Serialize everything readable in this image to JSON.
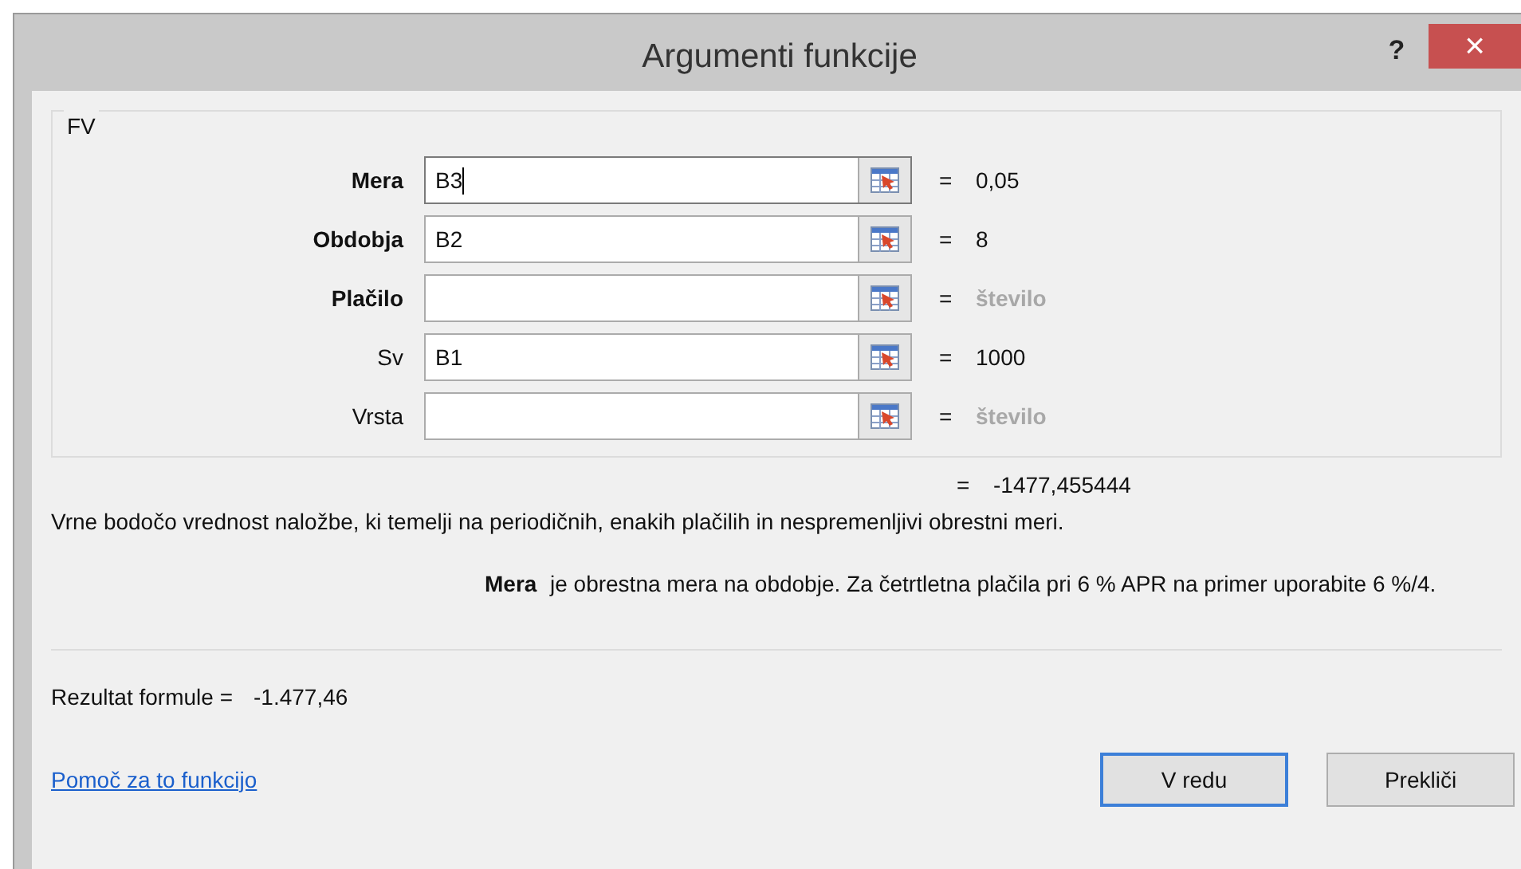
{
  "window": {
    "title": "Argumenti funkcije",
    "help": "?",
    "close": "×"
  },
  "function_name": "FV",
  "arguments": [
    {
      "label": "Mera",
      "required": true,
      "value": "B3",
      "focused": true,
      "result": "0,05",
      "result_muted": false
    },
    {
      "label": "Obdobja",
      "required": true,
      "value": "B2",
      "focused": false,
      "result": "8",
      "result_muted": false
    },
    {
      "label": "Plačilo",
      "required": true,
      "focused": false,
      "result": "število",
      "result_muted": true
    },
    {
      "label": "Sv",
      "required": false,
      "value": "B1",
      "focused": false,
      "result": "1000",
      "result_muted": false
    },
    {
      "label": "Vrsta",
      "required": false,
      "focused": false,
      "result": "število",
      "result_muted": true
    }
  ],
  "result_equals": "=",
  "function_result": "-1477,455444",
  "equals": "=",
  "description": "Vrne bodočo vrednost naložbe, ki temelji na periodičnih, enakih plačilih in nespremenljivi obrestni meri.",
  "argument_help": {
    "name": "Mera",
    "text": "je obrestna mera na obdobje. Za četrtletna plačila pri 6 % APR na primer uporabite 6 %/4."
  },
  "formula_result": {
    "label": "Rezultat formule =",
    "value": "-1.477,46"
  },
  "help_link": "Pomoč za to funkcijo",
  "buttons": [
    {
      "label": "V redu",
      "default": true
    },
    {
      "label": "Prekliči",
      "default": false
    }
  ]
}
